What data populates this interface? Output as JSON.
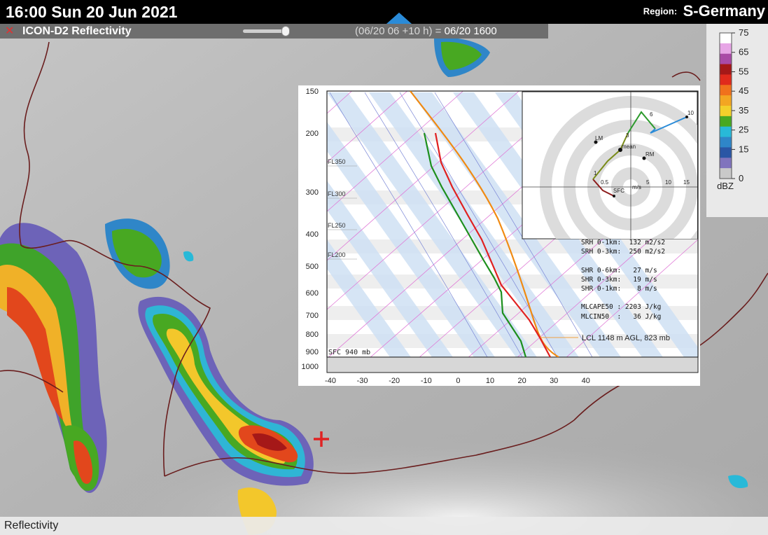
{
  "header": {
    "datetime": "16:00 Sun 20 Jun 2021",
    "region_label": "Region:",
    "region_value": "S-Germany"
  },
  "layer": {
    "close_symbol": "✕",
    "name": "ICON-D2 Reflectivity",
    "run_info": "(06/20 06 +10 h) =",
    "valid_time": "06/20 1600"
  },
  "sounding": {
    "pressure_labels": [
      "150",
      "200",
      "300",
      "400",
      "500",
      "600",
      "700",
      "800",
      "900",
      "1000"
    ],
    "fl_labels": [
      "FL350",
      "FL300",
      "FL250",
      "FL200"
    ],
    "temp_labels": [
      "-40",
      "-30",
      "-20",
      "-10",
      "0",
      "10",
      "20",
      "30",
      "40"
    ],
    "sfc_label": "SFC 940 mb",
    "lcl_label": "LCL 1148 m AGL, 823 mb",
    "hodograph": {
      "labels": {
        "lm": "LM",
        "rm": "RM",
        "mean": "mean",
        "sfc": "SFC",
        "unit": "m/s"
      },
      "ring_labels": [
        "0.5",
        "5",
        "10",
        "15"
      ],
      "point_labels": [
        "1",
        "3",
        "6",
        "10"
      ]
    },
    "indices": [
      "SRH 0-1km:  132 m2/s2",
      "SRH 0-3km:  250 m2/s2",
      "",
      "SHR 0-6km:   27 m/s",
      "SHR 0-3km:   19 m/s",
      "SHR 0-1km:    8 m/s",
      "",
      "MLCAPE50 : 2203 J/kg",
      "MLCIN50  :   36 J/kg"
    ]
  },
  "legend": {
    "unit": "dBZ",
    "ticks": [
      "75",
      "65",
      "55",
      "45",
      "35",
      "25",
      "15",
      "0"
    ],
    "colors": [
      "#ffffff",
      "#e7a6e6",
      "#a94aa6",
      "#a51818",
      "#e02a1c",
      "#f0711c",
      "#f3a622",
      "#f3d02b",
      "#48a822",
      "#28b9d8",
      "#2f86c8",
      "#2a56a5",
      "#8074bd",
      "#c9c9c9"
    ]
  },
  "marker": {
    "symbol": "+",
    "color": "#e02323"
  },
  "footer": {
    "label": "Reflectivity"
  }
}
